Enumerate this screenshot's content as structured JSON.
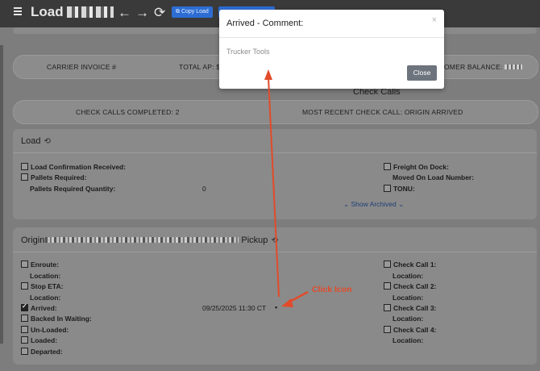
{
  "topbar": {
    "title": "Load",
    "copy_button": "Copy Load"
  },
  "summary": {
    "carrier_invoice": "CARRIER INVOICE #",
    "total_ap": "TOTAL AP: $",
    "customer_balance": "OMER BALANCE:"
  },
  "check_calls": {
    "heading": "Check Calls",
    "completed": "CHECK CALLS COMPLETED: 2",
    "most_recent": "MOST RECENT CHECK CALL: ORIGIN ARRIVED"
  },
  "load": {
    "title": "Load",
    "left_fields": {
      "load_confirmation": "Load Confirmation Received:",
      "pallets_required": "Pallets Required:",
      "pallets_required_qty_label": "Pallets Required Quantity:",
      "pallets_required_qty_value": "0"
    },
    "right_fields": {
      "freight_on_dock": "Freight On Dock:",
      "moved_on_load": "Moved On Load Number:",
      "tonu": "TONU:"
    },
    "show_archived": "Show Archived"
  },
  "origin": {
    "title_prefix": "Origin",
    "title_suffix": "Pickup",
    "enroute": "Enroute:",
    "location1": "Location:",
    "stop_eta": "Stop ETA:",
    "location2": "Location:",
    "arrived": "Arrived:",
    "arrived_value": "09/25/2025 11:30 CT",
    "backed_in_waiting": "Backed In Waiting:",
    "unloaded": "Un-Loaded:",
    "loaded": "Loaded:",
    "departed": "Departed:",
    "check_call_1": "Check Call 1:",
    "check_call_2": "Check Call 2:",
    "check_call_3": "Check Call 3:",
    "check_call_4": "Check Call 4:",
    "location": "Location:"
  },
  "modal": {
    "title": "Arrived - Comment:",
    "close_x": "×",
    "body": "Trucker Tools",
    "close_button": "Close"
  },
  "annotation": {
    "text": "Click Icon",
    "color": "#e24b2a"
  },
  "colors": {
    "overlay_gray": "#7d7d7d",
    "accent_blue": "#2d6dd3"
  }
}
